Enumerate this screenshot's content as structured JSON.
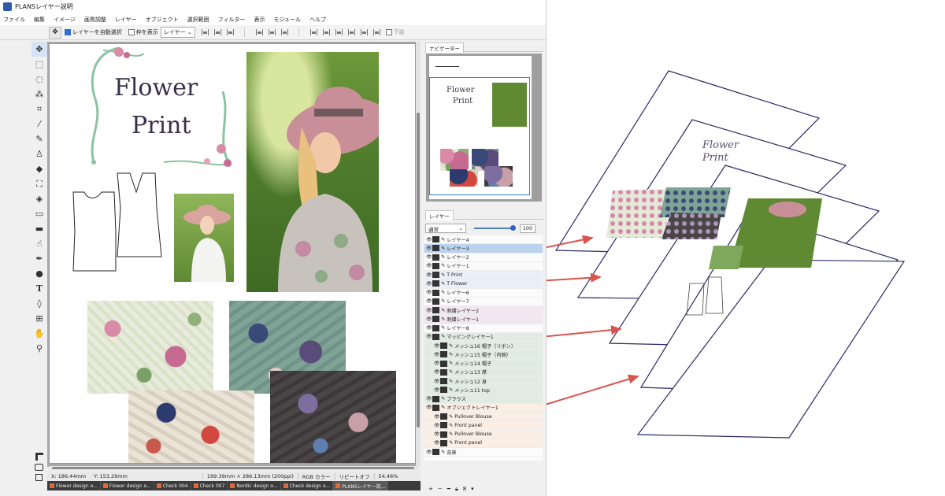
{
  "window": {
    "title": "PLANSレイヤー説明"
  },
  "menu": [
    "ファイル",
    "編集",
    "イメージ",
    "画質調整",
    "レイヤー",
    "オブジェクト",
    "選択範囲",
    "フィルター",
    "表示",
    "モジュール",
    "ヘルプ"
  ],
  "options": {
    "auto_select_label": "レイヤーを自動選択",
    "auto_select_checked": true,
    "show_frame_label": "枠を表示",
    "show_frame_checked": false,
    "target_value": "レイヤー",
    "apply_label": "下絵"
  },
  "tools": [
    "move-icon",
    "marquee-icon",
    "lasso-icon",
    "magic-wand-icon",
    "crop-icon",
    "eyedropper-icon",
    "brush-icon",
    "stamp-icon",
    "eraser-icon",
    "bucket-icon",
    "gradient-icon",
    "ruler-icon",
    "rectangle-icon",
    "smudge-icon",
    "pen-icon",
    "dodge-icon",
    "text-icon",
    "path-icon",
    "grid-icon",
    "hand-icon",
    "zoom-icon"
  ],
  "document": {
    "title_line1": "Flower",
    "title_line2": "Print"
  },
  "status": {
    "x_label": "X: 186.44mm",
    "y_label": "Y: 153.29mm",
    "size": "199.39mm × 286.13mm (200ppi)",
    "color_mode": "RGB カラー",
    "repeat": "リピートオフ",
    "zoom": "54.46%"
  },
  "taskbar": [
    {
      "label": "Flower design o...",
      "active": false
    },
    {
      "label": "Flower design o...",
      "active": false
    },
    {
      "label": "Check 004",
      "active": false
    },
    {
      "label": "Check 007",
      "active": false
    },
    {
      "label": "Nordic design o...",
      "active": false
    },
    {
      "label": "Check design o...",
      "active": false
    },
    {
      "label": "PLANSレイヤー説...",
      "active": true
    }
  ],
  "navigator": {
    "tab_label": "ナビゲーター",
    "page_title_line1": "Flower",
    "page_title_line2": "Print"
  },
  "layers_panel": {
    "tab_label": "レイヤー",
    "blend_mode": "通常",
    "opacity": "100",
    "rows": [
      {
        "name": "レイヤー4",
        "style": "",
        "indent": false
      },
      {
        "name": "レイヤー3",
        "style": "selected",
        "indent": false
      },
      {
        "name": "レイヤー2",
        "style": "",
        "indent": false
      },
      {
        "name": "レイヤー1",
        "style": "",
        "indent": false
      },
      {
        "name": "T  Print",
        "style": "text-l",
        "indent": false
      },
      {
        "name": "T  Flower",
        "style": "text-l",
        "indent": false
      },
      {
        "name": "レイヤー6",
        "style": "",
        "indent": false
      },
      {
        "name": "レイヤー7",
        "style": "",
        "indent": false
      },
      {
        "name": "刺繍レイヤー2",
        "style": "pink",
        "indent": false
      },
      {
        "name": "刺繍レイヤー1",
        "style": "pink",
        "indent": false
      },
      {
        "name": "レイヤー8",
        "style": "",
        "indent": false
      },
      {
        "name": "マッピングレイヤー1",
        "style": "green",
        "indent": false
      },
      {
        "name": "メッシュ16 帽子（リボン）",
        "style": "green",
        "indent": true
      },
      {
        "name": "メッシュ15 帽子（内側）",
        "style": "green",
        "indent": true
      },
      {
        "name": "メッシュ14 帽子",
        "style": "green",
        "indent": true
      },
      {
        "name": "メッシュ13 襟",
        "style": "green",
        "indent": true
      },
      {
        "name": "メッシュ12 身",
        "style": "green",
        "indent": true
      },
      {
        "name": "メッシュ11 top",
        "style": "green",
        "indent": true
      },
      {
        "name": "ブラウス",
        "style": "green",
        "indent": false
      },
      {
        "name": "オブジェクトレイヤー1",
        "style": "peach",
        "indent": false
      },
      {
        "name": "Pullover Blouse",
        "style": "peach",
        "indent": true
      },
      {
        "name": "Front panel",
        "style": "peach",
        "indent": true
      },
      {
        "name": "Pullover Blouse",
        "style": "peach",
        "indent": true
      },
      {
        "name": "Front panel",
        "style": "peach",
        "indent": true
      },
      {
        "name": "背景",
        "style": "",
        "indent": false
      }
    ],
    "bottom_value": "8"
  },
  "exploded": {
    "sheet1_title_line1": "Flower",
    "sheet1_title_line2": "Print",
    "colors": {
      "sheet_outline": "#2a2a66",
      "arrow": "#d9534f"
    }
  }
}
